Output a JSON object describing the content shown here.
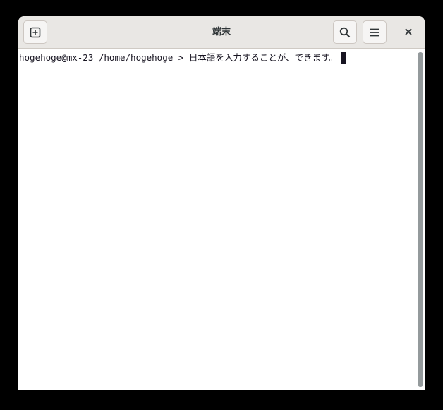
{
  "window": {
    "title": "端末"
  },
  "header": {
    "new_tab_icon": "new-tab-icon",
    "search_icon": "search-icon",
    "menu_icon": "hamburger-menu-icon",
    "close_icon": "close-icon"
  },
  "terminal": {
    "prompt": "hogehoge@mx-23 /home/hogehoge > ",
    "input": "日本語を入力することが、できます。"
  },
  "colors": {
    "titlebar": "#e9e7e4",
    "background": "#ffffff",
    "text": "#171421",
    "scrollbar": "#949a9c"
  }
}
